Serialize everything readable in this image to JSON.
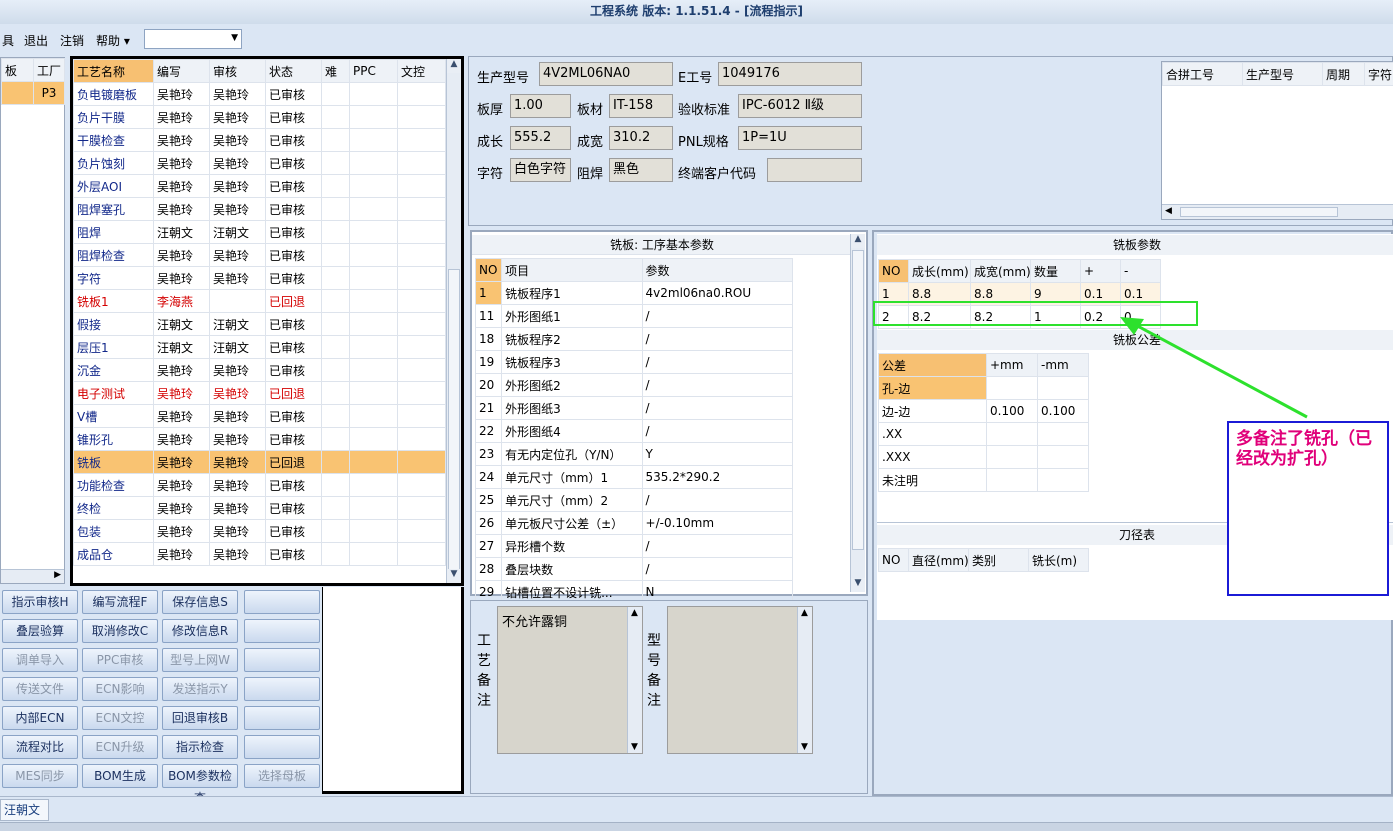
{
  "window": {
    "title": "工程系统   版本: 1.1.51.4 - [流程指示]"
  },
  "menu": {
    "items": [
      "具",
      "退出",
      "注销",
      "帮助 ▾"
    ]
  },
  "left_tree": {
    "headers": [
      "板",
      "工厂"
    ],
    "row_value": "P3"
  },
  "process_table": {
    "headers": [
      "工艺名称",
      "编写",
      "审核",
      "状态",
      "难",
      "PPC",
      "文控"
    ],
    "rows": [
      {
        "name": "负电镀磨板",
        "writer": "吴艳玲",
        "reviewer": "吴艳玲",
        "status": "已审核",
        "color": "normal"
      },
      {
        "name": "负片干膜",
        "writer": "吴艳玲",
        "reviewer": "吴艳玲",
        "status": "已审核",
        "color": "normal"
      },
      {
        "name": "干膜检查",
        "writer": "吴艳玲",
        "reviewer": "吴艳玲",
        "status": "已审核",
        "color": "normal"
      },
      {
        "name": "负片蚀刻",
        "writer": "吴艳玲",
        "reviewer": "吴艳玲",
        "status": "已审核",
        "color": "normal"
      },
      {
        "name": "外层AOI",
        "writer": "吴艳玲",
        "reviewer": "吴艳玲",
        "status": "已审核",
        "color": "normal"
      },
      {
        "name": "阻焊塞孔",
        "writer": "吴艳玲",
        "reviewer": "吴艳玲",
        "status": "已审核",
        "color": "normal"
      },
      {
        "name": "阻焊",
        "writer": "汪朝文",
        "reviewer": "汪朝文",
        "status": "已审核",
        "color": "normal"
      },
      {
        "name": "阻焊检查",
        "writer": "吴艳玲",
        "reviewer": "吴艳玲",
        "status": "已审核",
        "color": "normal"
      },
      {
        "name": "字符",
        "writer": "吴艳玲",
        "reviewer": "吴艳玲",
        "status": "已审核",
        "color": "normal"
      },
      {
        "name": "铣板1",
        "writer": "李海燕",
        "reviewer": "",
        "status": "已回退",
        "color": "red"
      },
      {
        "name": "假接",
        "writer": "汪朝文",
        "reviewer": "汪朝文",
        "status": "已审核",
        "color": "normal"
      },
      {
        "name": "层压1",
        "writer": "汪朝文",
        "reviewer": "汪朝文",
        "status": "已审核",
        "color": "normal"
      },
      {
        "name": "沉金",
        "writer": "吴艳玲",
        "reviewer": "吴艳玲",
        "status": "已审核",
        "color": "normal"
      },
      {
        "name": "电子测试",
        "writer": "吴艳玲",
        "reviewer": "吴艳玲",
        "status": "已回退",
        "color": "red"
      },
      {
        "name": "V槽",
        "writer": "吴艳玲",
        "reviewer": "吴艳玲",
        "status": "已审核",
        "color": "normal"
      },
      {
        "name": "锥形孔",
        "writer": "吴艳玲",
        "reviewer": "吴艳玲",
        "status": "已审核",
        "color": "normal"
      },
      {
        "name": "铣板",
        "writer": "吴艳玲",
        "reviewer": "吴艳玲",
        "status": "已回退",
        "color": "selected"
      },
      {
        "name": "功能检查",
        "writer": "吴艳玲",
        "reviewer": "吴艳玲",
        "status": "已审核",
        "color": "normal"
      },
      {
        "name": "终检",
        "writer": "吴艳玲",
        "reviewer": "吴艳玲",
        "status": "已审核",
        "color": "normal"
      },
      {
        "name": "包装",
        "writer": "吴艳玲",
        "reviewer": "吴艳玲",
        "status": "已审核",
        "color": "normal"
      },
      {
        "name": "成品仓",
        "writer": "吴艳玲",
        "reviewer": "吴艳玲",
        "status": "已审核",
        "color": "normal"
      }
    ]
  },
  "buttons": [
    [
      "指示审核H",
      "编写流程F",
      "保存信息S",
      ""
    ],
    [
      "叠层验算",
      "取消修改C",
      "修改信息R",
      ""
    ],
    [
      "调单导入",
      "PPC审核",
      "型号上网W",
      ""
    ],
    [
      "传送文件",
      "ECN影响",
      "发送指示Y",
      ""
    ],
    [
      "内部ECN",
      "ECN文控",
      "回退审核B",
      ""
    ],
    [
      "流程对比",
      "ECN升级",
      "指示检查",
      ""
    ],
    [
      "MES同步",
      "BOM生成",
      "BOM参数检查",
      "选择母板"
    ]
  ],
  "buttons_disabled": [
    [
      false,
      false,
      false,
      false
    ],
    [
      false,
      false,
      false,
      false
    ],
    [
      true,
      true,
      true,
      false
    ],
    [
      true,
      true,
      true,
      false
    ],
    [
      false,
      true,
      false,
      false
    ],
    [
      false,
      true,
      false,
      false
    ],
    [
      true,
      false,
      false,
      true
    ]
  ],
  "info": {
    "model_label": "生产型号",
    "model_value": "4V2ML06NA0",
    "eno_label": "E工号",
    "eno_value": "1049176",
    "thick_label": "板厚",
    "thick_value": "1.00",
    "material_label": "板材",
    "material_value": "IT-158",
    "std_label": "验收标准",
    "std_value": "IPC-6012 Ⅱ级",
    "length_label": "成长",
    "length_value": "555.2",
    "width_label": "成宽",
    "width_value": "310.2",
    "pnl_label": "PNL规格",
    "pnl_value": "1P=1U",
    "char_label": "字符",
    "char_value": "白色字符",
    "mask_label": "阻焊",
    "mask_value": "黑色",
    "cust_label": "终端客户代码",
    "cust_value": ""
  },
  "merge_table": {
    "headers": [
      "合拼工号",
      "生产型号",
      "周期",
      "字符"
    ]
  },
  "params": {
    "title": "铣板: 工序基本参数",
    "headers": [
      "NO",
      "项目",
      "参数"
    ],
    "rows": [
      [
        "1",
        "铣板程序1",
        "4v2ml06na0.ROU"
      ],
      [
        "11",
        "外形图纸1",
        "/"
      ],
      [
        "18",
        "铣板程序2",
        "/"
      ],
      [
        "19",
        "铣板程序3",
        "/"
      ],
      [
        "20",
        "外形图纸2",
        "/"
      ],
      [
        "21",
        "外形图纸3",
        "/"
      ],
      [
        "22",
        "外形图纸4",
        "/"
      ],
      [
        "23",
        "有无内定位孔（Y/N）",
        "Y"
      ],
      [
        "24",
        "单元尺寸（mm）1",
        "535.2*290.2"
      ],
      [
        "25",
        "单元尺寸（mm）2",
        "/"
      ],
      [
        "26",
        "单元板尺寸公差（±）",
        "+/-0.10mm"
      ],
      [
        "27",
        "异形槽个数",
        "/"
      ],
      [
        "28",
        "叠层块数",
        "/"
      ],
      [
        "29",
        "钻槽位置不设计铣...",
        "N"
      ]
    ]
  },
  "mill": {
    "title": "铣板参数",
    "headers": [
      "NO",
      "成长(mm)",
      "成宽(mm)",
      "数量",
      "+",
      "-"
    ],
    "rows": [
      [
        "1",
        "8.8",
        "8.8",
        "9",
        "0.1",
        "0.1"
      ],
      [
        "2",
        "8.2",
        "8.2",
        "1",
        "0.2",
        "0"
      ]
    ]
  },
  "tolerance": {
    "title": "铣板公差",
    "headers": [
      "公差",
      "+mm",
      "-mm"
    ],
    "rows": [
      [
        "孔-边",
        "",
        ""
      ],
      [
        "边-边",
        "0.100",
        "0.100"
      ],
      [
        ".XX",
        "",
        ""
      ],
      [
        ".XXX",
        "",
        ""
      ],
      [
        "未注明",
        "",
        ""
      ]
    ]
  },
  "tool": {
    "title": "刀径表",
    "headers": [
      "NO",
      "直径(mm)",
      "类别",
      "铣长(m)"
    ]
  },
  "remarks": {
    "craft_label": "工艺备注",
    "craft_text": "不允许露铜",
    "model_label": "型号备注",
    "model_text": ""
  },
  "annotation": {
    "text": "多备注了铣孔（已经改为扩孔）"
  },
  "status": {
    "user": "汪朝文"
  },
  "colors": {
    "selected_row": "#f9c372",
    "highlight_box": "#2de12d",
    "annotation_border": "#1b1bd6",
    "annotation_text": "#e0007a",
    "arrow": "#2de12d"
  }
}
